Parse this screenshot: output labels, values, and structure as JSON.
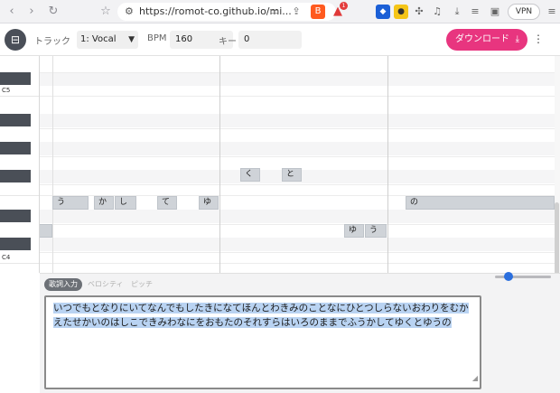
{
  "browser": {
    "back": "‹",
    "forward": "›",
    "reload": "↻",
    "bookmark": "☆",
    "url": "https://romot-co.github.io/mi...",
    "extension_badge": "1",
    "vpn_label": "VPN"
  },
  "toolbar": {
    "track_label": "トラック",
    "track_value": "1: Vocal",
    "bpm_label": "BPM",
    "bpm_value": "160",
    "key_label": "キー",
    "key_value": "0",
    "download_label": "ダウンロード"
  },
  "piano": {
    "labels": [
      "C5",
      "C4"
    ]
  },
  "notes": [
    {
      "text": "く"
    },
    {
      "text": "と"
    },
    {
      "text": "う"
    },
    {
      "text": "か"
    },
    {
      "text": "し"
    },
    {
      "text": "て"
    },
    {
      "text": "ゆ"
    },
    {
      "text": "の"
    },
    {
      "text": "ゆ"
    },
    {
      "text": "う"
    }
  ],
  "tabs": [
    "歌詞入力",
    "ベロシティ",
    "ピッチ"
  ],
  "lyrics": {
    "text": "いつでもとなりにいてなんでもしたきになてほんとわきみのことなにひとつしらないおわりをむかえたせかいのはしこできみわなにをおもたのそれすらはいろのままでふうかしてゆくとゆうの"
  },
  "colors": {
    "accent": "#e8357f",
    "slider": "#2b6fde"
  }
}
